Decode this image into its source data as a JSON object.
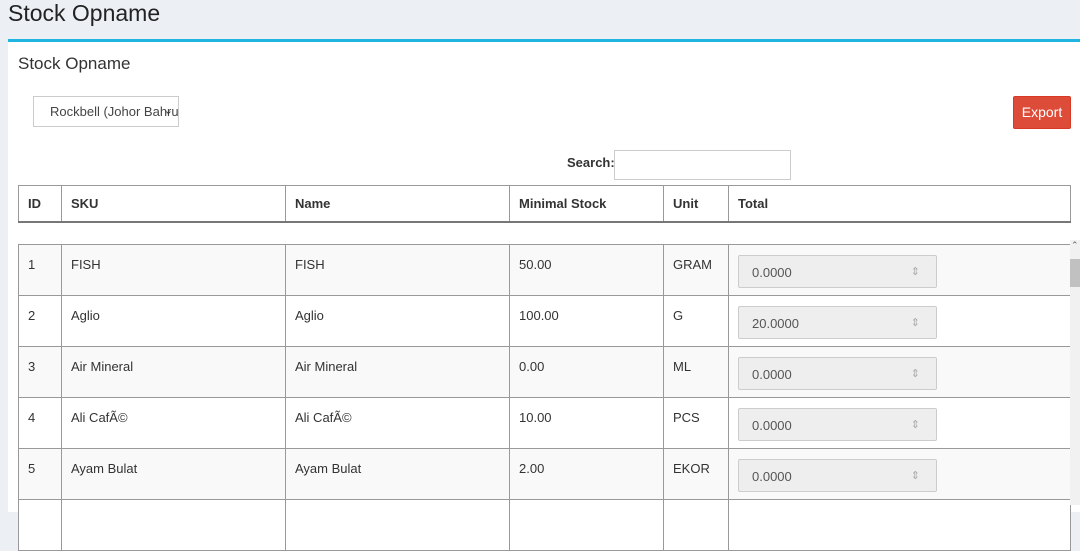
{
  "page": {
    "title": "Stock Opname"
  },
  "box": {
    "title": "Stock Opname"
  },
  "toolbar": {
    "outlet_selected": "Rockbell (Johor Bahru)",
    "export_label": "Export"
  },
  "search": {
    "label": "Search:",
    "value": ""
  },
  "table": {
    "headers": [
      "ID",
      "SKU",
      "Name",
      "Minimal Stock",
      "Unit",
      "Total"
    ],
    "rows": [
      {
        "id": "1",
        "sku": "FISH",
        "name": "FISH",
        "min_stock": "50.00",
        "unit": "GRAM",
        "total": "0.0000"
      },
      {
        "id": "2",
        "sku": "Aglio",
        "name": "Aglio",
        "min_stock": "100.00",
        "unit": "G",
        "total": "20.0000"
      },
      {
        "id": "3",
        "sku": "Air Mineral",
        "name": "Air Mineral",
        "min_stock": "0.00",
        "unit": "ML",
        "total": "0.0000"
      },
      {
        "id": "4",
        "sku": "Ali CafÃ©",
        "name": "Ali CafÃ©",
        "min_stock": "10.00",
        "unit": "PCS",
        "total": "0.0000"
      },
      {
        "id": "5",
        "sku": "Ayam Bulat",
        "name": "Ayam Bulat",
        "min_stock": "2.00",
        "unit": "EKOR",
        "total": "0.0000"
      }
    ]
  },
  "icons": {
    "select": "chevron-down-icon",
    "spinner": "spinner-arrows-icon"
  },
  "colors": {
    "accent": "#1fb5e0",
    "export": "#dd4b39"
  }
}
